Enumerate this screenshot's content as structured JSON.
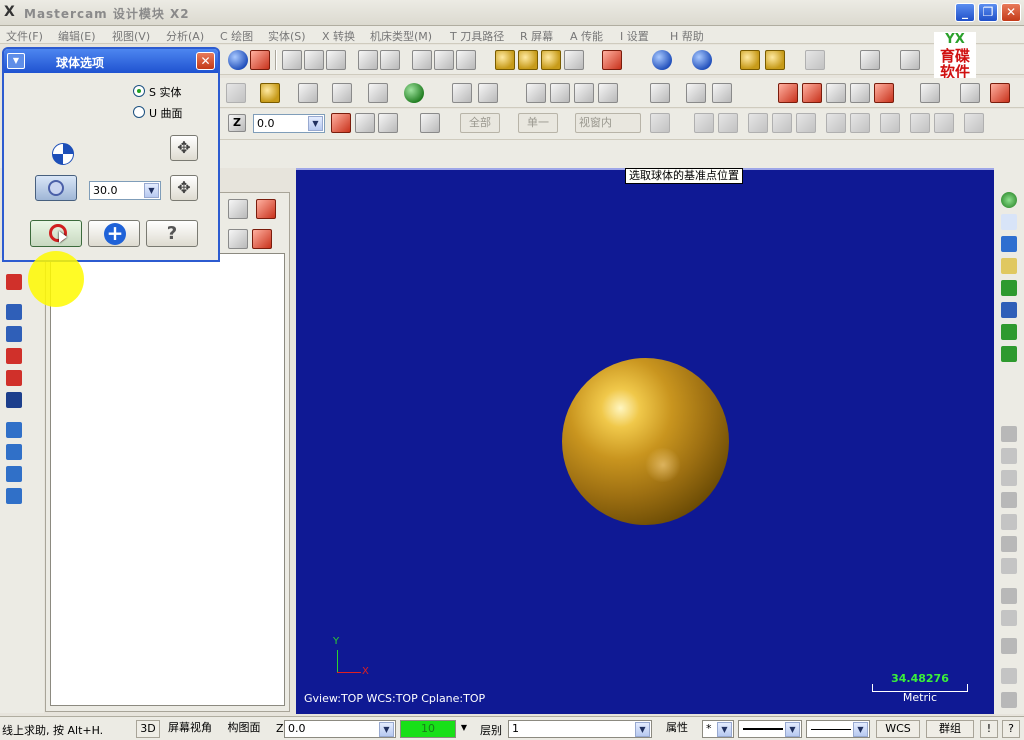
{
  "window": {
    "title": "Mastercam 设计模块  X2",
    "minimize": "_",
    "restore": "❐",
    "close": "✕"
  },
  "menu": [
    "文件(F)",
    "编辑(E)",
    "视图(V)",
    "分析(A)",
    "C 绘图",
    "实体(S)",
    "X 转换",
    "机床类型(M)",
    "T 刀具路径",
    "R 屏幕",
    "A 传能",
    "I 设置",
    "H 帮助"
  ],
  "logo": {
    "top": "YX",
    "bottom": "育碟软件"
  },
  "toolbar3": {
    "z_button": "Z",
    "z_value": "0.0",
    "btn_all": "全部",
    "btn_single": "单一",
    "btn_view": "视窗内"
  },
  "dialog": {
    "title": "球体选项",
    "close": "✕",
    "menu_icon": "▼",
    "radio_solid": "S 实体",
    "radio_surface": "U 曲面",
    "radius_value": "30.0",
    "ok_icon": "ok-check",
    "help": "?"
  },
  "viewport": {
    "tooltip": "选取球体的基准点位置",
    "status": "Gview:TOP   WCS:TOP   Cplane:TOP",
    "axis_y": "Y",
    "axis_x": "X",
    "scale_value": "34.48276",
    "scale_unit": "Metric",
    "background": "#0f1994"
  },
  "statusbar": {
    "hint": "线上求助, 按 Alt+H.",
    "btn_3d": "3D",
    "screen_view": "屏幕视角",
    "plane": "构图面",
    "z_label": "Z",
    "z_value": "0.0",
    "color_value": "10",
    "level_label": "层别",
    "level_value": "1",
    "attr_label": "属性",
    "point_style": "*",
    "wcs": "WCS",
    "group": "群组",
    "excl": "!",
    "q": "?"
  }
}
